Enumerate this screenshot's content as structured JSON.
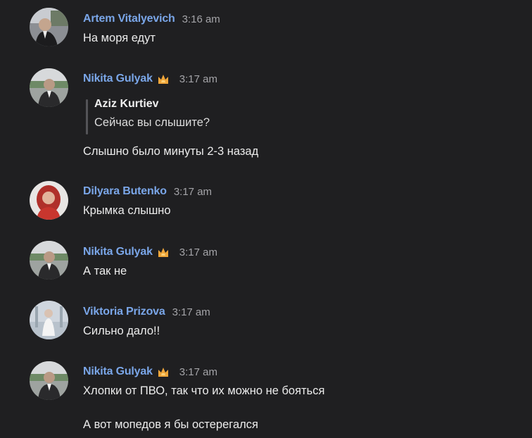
{
  "colors": {
    "background": "#1f1f21",
    "author_name": "#7aa6e8",
    "timestamp": "#a4a4a8",
    "message_text": "#ececec",
    "badge": "#f0a63a"
  },
  "messages": [
    {
      "author": "Artem Vitalyevich",
      "time": "3:16 am",
      "avatar_icon": "user-photo-icon",
      "text": "На моря едут"
    },
    {
      "author": "Nikita Gulyak",
      "badge_icon": "crown-badge-icon",
      "time": "3:17 am",
      "avatar_icon": "user-photo-icon",
      "reply": {
        "author": "Aziz Kurtiev",
        "text": "Сейчас вы слышите?"
      },
      "text": "Слышно было минуты 2-3 назад"
    },
    {
      "author": "Dilyara Butenko",
      "time": "3:17 am",
      "avatar_icon": "user-photo-icon",
      "text": "Крымка слышно"
    },
    {
      "author": "Nikita Gulyak",
      "badge_icon": "crown-badge-icon",
      "time": "3:17 am",
      "avatar_icon": "user-photo-icon",
      "text": "А так не"
    },
    {
      "author": "Viktoria Prizova",
      "time": "3:17 am",
      "avatar_icon": "user-photo-icon",
      "text": "Сильно дало!!"
    },
    {
      "author": "Nikita Gulyak",
      "badge_icon": "crown-badge-icon",
      "time": "3:17 am",
      "avatar_icon": "user-photo-icon",
      "text": "Хлопки от ПВО, так что их можно не бояться",
      "text2": "А вот мопедов я бы остерегался"
    }
  ]
}
